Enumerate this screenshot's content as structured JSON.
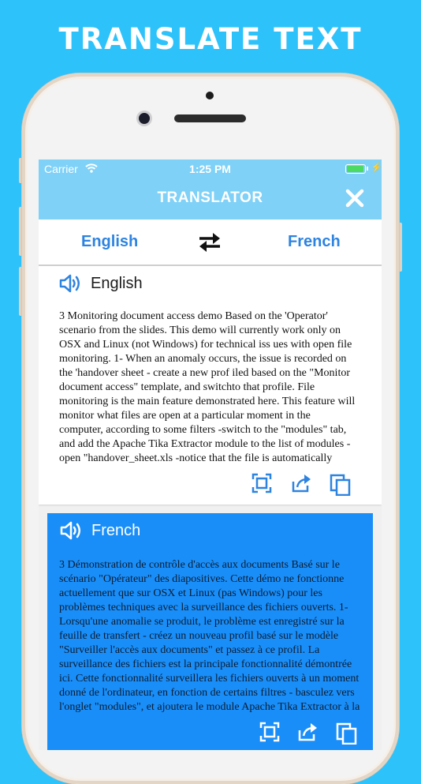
{
  "promo": {
    "title": "TRANSLATE TEXT"
  },
  "status": {
    "carrier": "Carrier",
    "time": "1:25 PM"
  },
  "nav": {
    "title": "TRANSLATOR"
  },
  "languages": {
    "source": "English",
    "target": "French"
  },
  "source_card": {
    "language": "English",
    "text": "3 Monitoring document access demo Based on the 'Operator' scenario from the slides. This demo will currently work only on OSX and Linux (not Windows) for technical iss ues with open file monitoring. 1- When an anomaly occurs, the issue is recorded on the 'handover sheet - create a new prof iled based on the \"Monitor document access\" template, and switchto that profile. File monitoring is the main feature demonstrated here. This feature will monitor what files are open at a particular moment in the computer, according to some filters -switch to the \"modules\" tab, and add the Apache Tika Extractor module to the list of modules - open \"handover_sheet.xls -notice that the file is automatically added to"
  },
  "target_card": {
    "language": "French",
    "text": "3 Démonstration de contrôle d'accès aux documents Basé sur le scénario \"Opérateur\" des diapositives. Cette démo ne fonctionne actuellement que sur OSX et Linux (pas Windows) pour les problèmes techniques avec la surveillance des fichiers ouverts. 1- Lorsqu'une anomalie se produit, le problème est enregistré sur la feuille de transfert - créez un nouveau profil basé sur le modèle \"Surveiller l'accès aux documents\" et passez à ce profil. La surveillance des fichiers est la principale fonctionnalité démontrée ici. Cette fonctionnalité surveillera les fichiers ouverts à un moment donné de l'ordinateur, en fonction de certains filtres - basculez vers l'onglet \"modules\", et ajoutera le module Apache Tika Extractor à la"
  },
  "colors": {
    "background": "#2ec2fb",
    "navbar": "#7fd1f7",
    "accent": "#2d83e0",
    "target_card": "#1a8ef8"
  },
  "icons": [
    "wifi-icon",
    "battery-icon",
    "close-icon",
    "swap-icon",
    "speaker-icon",
    "fullscreen-icon",
    "share-icon",
    "copy-icon"
  ]
}
